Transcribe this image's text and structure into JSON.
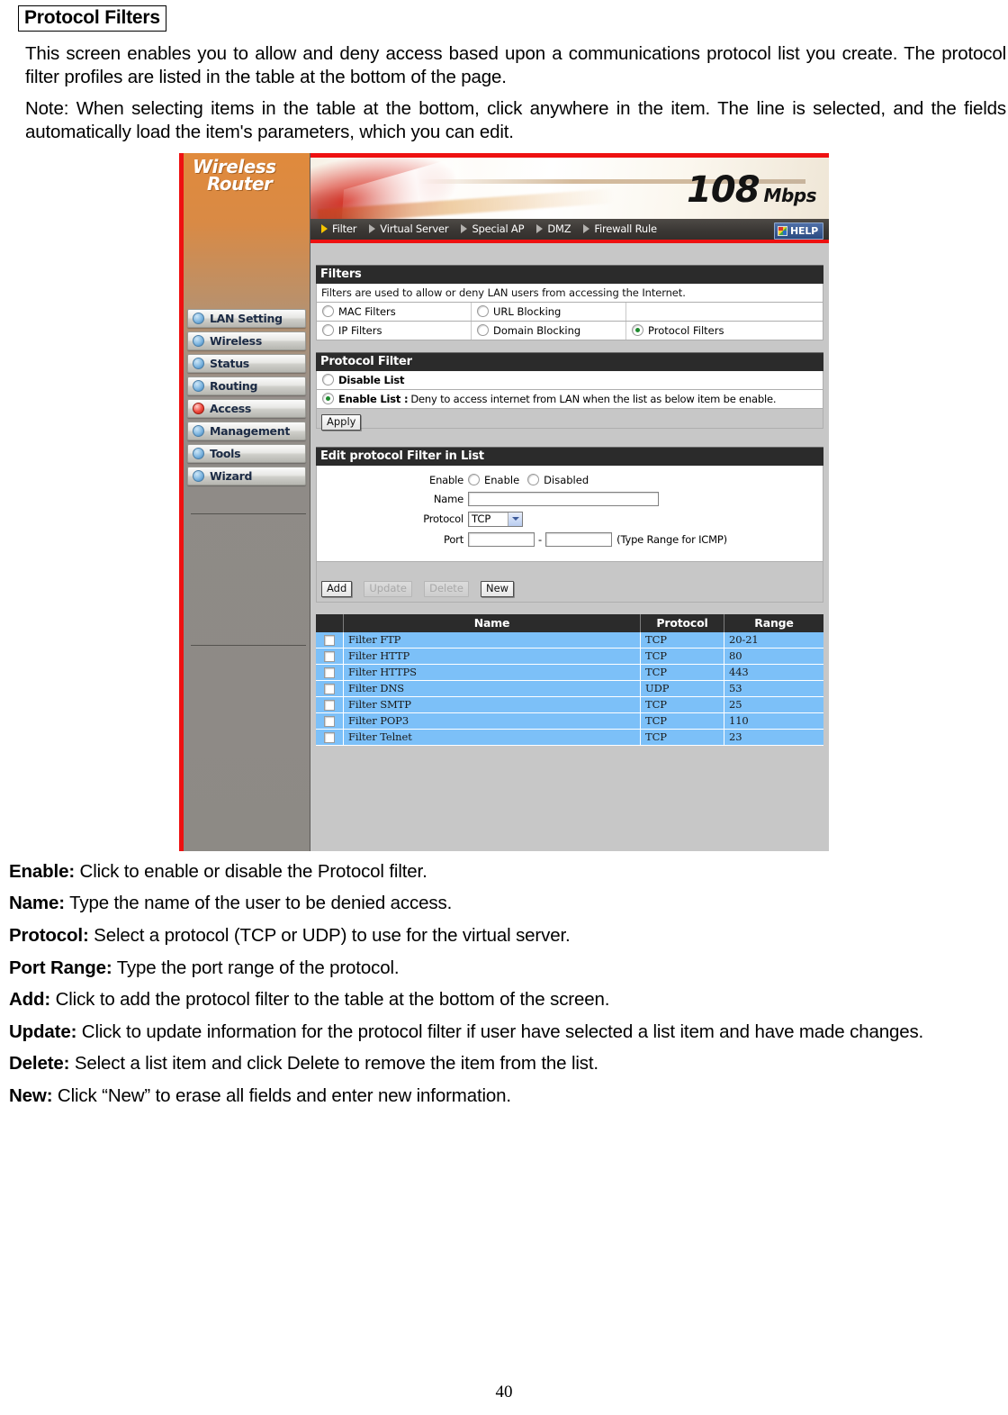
{
  "document": {
    "section_title": "Protocol Filters",
    "paragraphs": [
      "This screen enables you to allow and deny access based upon a communications protocol list you create. The protocol filter profiles are listed in the table at the bottom of the page.",
      "Note: When selecting items in the table at the bottom, click anywhere in the item. The line is selected, and the fields automatically load the item's parameters, which you can edit."
    ],
    "descriptions": [
      {
        "label": "Enable:",
        "text": " Click to enable or disable the Protocol filter."
      },
      {
        "label": "Name:",
        "text": " Type the name of the user to be denied access."
      },
      {
        "label": "Protocol:",
        "text": " Select a protocol (TCP or UDP) to use for the virtual server."
      },
      {
        "label": "Port Range:",
        "text": " Type the port range of the protocol."
      },
      {
        "label": "Add:",
        "text": " Click to add the protocol filter to the table at the bottom of the screen."
      },
      {
        "label": "Update:",
        "text": " Click to update information for the protocol filter if user have selected a list item and have made changes."
      },
      {
        "label": "Delete:",
        "text": " Select a list item and click Delete to remove the item from the list."
      },
      {
        "label": "New:",
        "text": " Click “New” to erase all fields and enter new information."
      }
    ],
    "page_number": "40"
  },
  "router_ui": {
    "brand": {
      "line1": "Wireless",
      "line2": "Router"
    },
    "banner": {
      "speed_number": "108",
      "speed_unit": "Mbps"
    },
    "menubar": {
      "items": [
        {
          "label": "Filter",
          "active": true
        },
        {
          "label": "Virtual Server",
          "active": false
        },
        {
          "label": "Special AP",
          "active": false
        },
        {
          "label": "DMZ",
          "active": false
        },
        {
          "label": "Firewall Rule",
          "active": false
        }
      ],
      "help_label": "HELP"
    },
    "sidebar": {
      "items": [
        {
          "label": "LAN Setting",
          "selected": false
        },
        {
          "label": "Wireless",
          "selected": false
        },
        {
          "label": "Status",
          "selected": false
        },
        {
          "label": "Routing",
          "selected": false
        },
        {
          "label": "Access",
          "selected": true
        },
        {
          "label": "Management",
          "selected": false
        },
        {
          "label": "Tools",
          "selected": false
        },
        {
          "label": "Wizard",
          "selected": false
        }
      ]
    },
    "filters_panel": {
      "title": "Filters",
      "description": "Filters are used to allow or deny LAN users from accessing the Internet.",
      "options": [
        {
          "label": "MAC Filters",
          "selected": false
        },
        {
          "label": "URL Blocking",
          "selected": false
        },
        {
          "label": "IP Filters",
          "selected": false
        },
        {
          "label": "Domain Blocking",
          "selected": false
        },
        {
          "label": "Protocol Filters",
          "selected": true
        }
      ]
    },
    "protocol_filter_panel": {
      "title": "Protocol Filter",
      "disable_label": "Disable List",
      "enable_label": "Enable List :",
      "enable_desc": "Deny to access internet from LAN when the list as below item be enable.",
      "apply_label": "Apply"
    },
    "edit_panel": {
      "title": "Edit protocol Filter in List",
      "enable_label": "Enable",
      "enable_option": "Enable",
      "disabled_option": "Disabled",
      "name_label": "Name",
      "name_value": "",
      "protocol_label": "Protocol",
      "protocol_value": "TCP",
      "protocol_options": [
        "TCP",
        "UDP"
      ],
      "port_label": "Port",
      "port_start": "",
      "port_end": "",
      "port_sep": "-",
      "port_hint": "(Type Range for ICMP)"
    },
    "action_buttons": [
      {
        "label": "Add",
        "disabled": false
      },
      {
        "label": "Update",
        "disabled": true
      },
      {
        "label": "Delete",
        "disabled": true
      },
      {
        "label": "New",
        "disabled": false
      }
    ],
    "filter_table": {
      "columns": [
        "",
        "Name",
        "Protocol",
        "Range"
      ],
      "rows": [
        {
          "name": "Filter FTP",
          "protocol": "TCP",
          "range": "20-21"
        },
        {
          "name": "Filter HTTP",
          "protocol": "TCP",
          "range": "80"
        },
        {
          "name": "Filter HTTPS",
          "protocol": "TCP",
          "range": "443"
        },
        {
          "name": "Filter DNS",
          "protocol": "UDP",
          "range": "53"
        },
        {
          "name": "Filter SMTP",
          "protocol": "TCP",
          "range": "25"
        },
        {
          "name": "Filter POP3",
          "protocol": "TCP",
          "range": "110"
        },
        {
          "name": "Filter Telnet",
          "protocol": "TCP",
          "range": "23"
        }
      ]
    }
  }
}
